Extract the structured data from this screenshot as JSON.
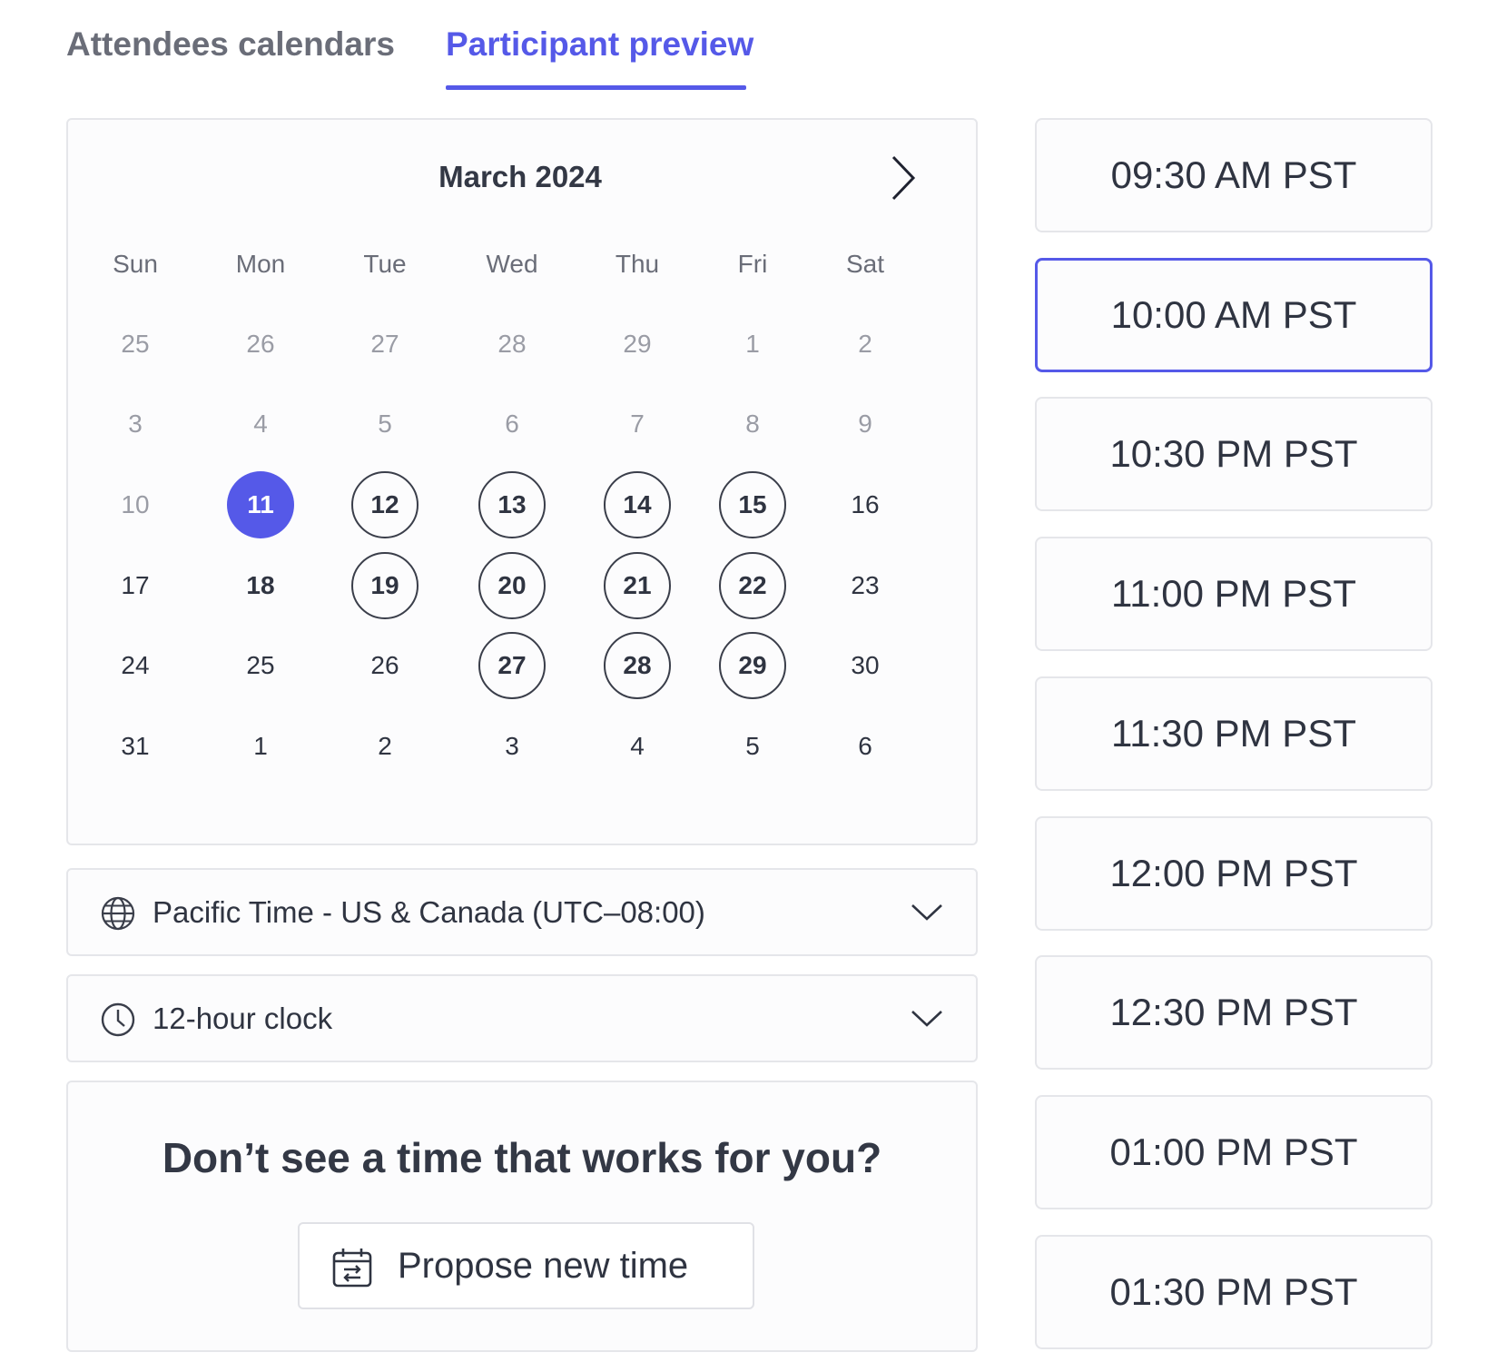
{
  "tabs": {
    "attendees": "Attendees calendars",
    "preview": "Participant preview",
    "active": "preview"
  },
  "calendar": {
    "month_label": "March 2024",
    "next_icon": "chevron-right-icon",
    "weekdays": [
      "Sun",
      "Mon",
      "Tue",
      "Wed",
      "Thu",
      "Fri",
      "Sat"
    ],
    "weeks": [
      [
        {
          "d": "25",
          "s": "muted"
        },
        {
          "d": "26",
          "s": "muted"
        },
        {
          "d": "27",
          "s": "muted"
        },
        {
          "d": "28",
          "s": "muted"
        },
        {
          "d": "29",
          "s": "muted"
        },
        {
          "d": "1",
          "s": "muted"
        },
        {
          "d": "2",
          "s": "muted"
        }
      ],
      [
        {
          "d": "3",
          "s": "muted"
        },
        {
          "d": "4",
          "s": "muted"
        },
        {
          "d": "5",
          "s": "muted"
        },
        {
          "d": "6",
          "s": "muted"
        },
        {
          "d": "7",
          "s": "muted"
        },
        {
          "d": "8",
          "s": "muted"
        },
        {
          "d": "9",
          "s": "muted"
        }
      ],
      [
        {
          "d": "10",
          "s": "muted"
        },
        {
          "d": "11",
          "s": "selected"
        },
        {
          "d": "12",
          "s": "available"
        },
        {
          "d": "13",
          "s": "available"
        },
        {
          "d": "14",
          "s": "available"
        },
        {
          "d": "15",
          "s": "available"
        },
        {
          "d": "16",
          "s": "normal"
        }
      ],
      [
        {
          "d": "17",
          "s": "normal"
        },
        {
          "d": "18",
          "s": "today"
        },
        {
          "d": "19",
          "s": "available"
        },
        {
          "d": "20",
          "s": "available"
        },
        {
          "d": "21",
          "s": "available"
        },
        {
          "d": "22",
          "s": "available"
        },
        {
          "d": "23",
          "s": "normal"
        }
      ],
      [
        {
          "d": "24",
          "s": "normal"
        },
        {
          "d": "25",
          "s": "normal"
        },
        {
          "d": "26",
          "s": "normal"
        },
        {
          "d": "27",
          "s": "available"
        },
        {
          "d": "28",
          "s": "available"
        },
        {
          "d": "29",
          "s": "available"
        },
        {
          "d": "30",
          "s": "normal"
        }
      ],
      [
        {
          "d": "31",
          "s": "normal"
        },
        {
          "d": "1",
          "s": "normal"
        },
        {
          "d": "2",
          "s": "normal"
        },
        {
          "d": "3",
          "s": "normal"
        },
        {
          "d": "4",
          "s": "normal"
        },
        {
          "d": "5",
          "s": "normal"
        },
        {
          "d": "6",
          "s": "normal"
        }
      ]
    ]
  },
  "timezone": {
    "icon": "globe-icon",
    "label": "Pacific Time - US & Canada (UTC–08:00)"
  },
  "clock_format": {
    "icon": "clock-icon",
    "label": "12-hour clock"
  },
  "propose": {
    "title": "Don’t see a time that works for you?",
    "button_icon": "calendar-swap-icon",
    "button_label": "Propose new time"
  },
  "time_slots": [
    {
      "label": "09:30 AM PST",
      "selected": false
    },
    {
      "label": "10:00 AM PST",
      "selected": true
    },
    {
      "label": "10:30 PM PST",
      "selected": false
    },
    {
      "label": "11:00 PM PST",
      "selected": false
    },
    {
      "label": "11:30 PM PST",
      "selected": false
    },
    {
      "label": "12:00 PM PST",
      "selected": false
    },
    {
      "label": "12:30 PM PST",
      "selected": false
    },
    {
      "label": "01:00 PM PST",
      "selected": false
    },
    {
      "label": "01:30 PM PST",
      "selected": false
    }
  ],
  "colors": {
    "accent": "#5559e8",
    "text": "#2f3441",
    "muted": "#9a9ca5",
    "border": "#e5e6ea"
  }
}
